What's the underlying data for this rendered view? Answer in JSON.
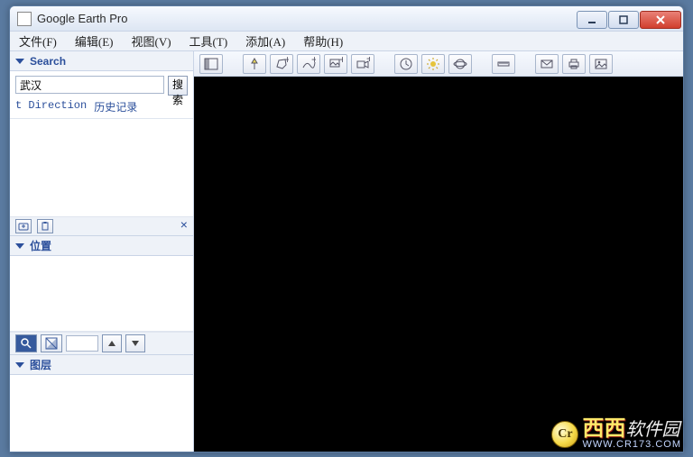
{
  "window": {
    "title": "Google Earth Pro"
  },
  "menu": {
    "file": "文件(F)",
    "edit": "编辑(E)",
    "view": "视图(V)",
    "tools": "工具(T)",
    "add": "添加(A)",
    "help": "帮助(H)"
  },
  "sidebar": {
    "search": {
      "title": "Search",
      "value": "武汉",
      "button": "搜索",
      "link_directions": "t Direction",
      "link_history": "历史记录"
    },
    "places": {
      "title": "位置",
      "opacity_value": ""
    },
    "layers": {
      "title": "图层"
    }
  },
  "toolbar_icons": [
    "hide-sidebar",
    "placemark",
    "polygon",
    "path",
    "image-overlay",
    "record-tour",
    "historical-imagery",
    "sunlight",
    "planets",
    "ruler",
    "email",
    "print",
    "save-image"
  ],
  "watermark": {
    "badge": "Cr",
    "c1": "西",
    "c2": "西",
    "suffix": "软件园",
    "url": "WWW.CR173.COM"
  }
}
